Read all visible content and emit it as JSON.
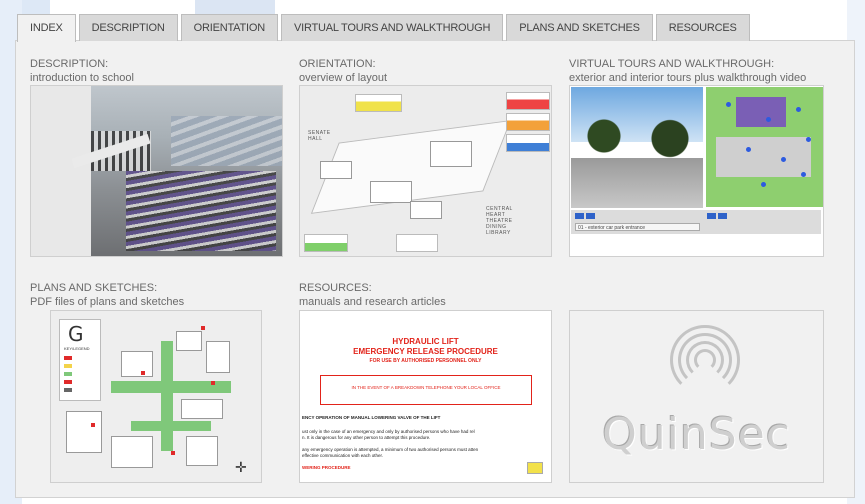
{
  "tabs": [
    {
      "label": "INDEX",
      "active": true
    },
    {
      "label": "DESCRIPTION",
      "active": false
    },
    {
      "label": "ORIENTATION",
      "active": false
    },
    {
      "label": "VIRTUAL TOURS AND WALKTHROUGH",
      "active": false
    },
    {
      "label": "PLANS AND SKETCHES",
      "active": false
    },
    {
      "label": "RESOURCES",
      "active": false
    }
  ],
  "cards": {
    "description": {
      "title": "DESCRIPTION:",
      "subtitle": "introduction to school"
    },
    "orientation": {
      "title": "ORIENTATION:",
      "subtitle": "overview of layout"
    },
    "virtual": {
      "title": "VIRTUAL TOURS AND WALKTHROUGH:",
      "subtitle": "exterior and interior tours plus walkthrough video"
    },
    "plans": {
      "title": "PLANS AND SKETCHES:",
      "subtitle": "PDF files of plans and sketches"
    },
    "resources": {
      "title": "RESOURCES:",
      "subtitle": "manuals and research articles"
    }
  },
  "orientation_thumb": {
    "label_left": "SENATE HALL",
    "label_right": "CENTRAL HEART THEATRE DINING LIBRARY"
  },
  "virtual_thumb": {
    "select_value": "01 - exterior car park entrance"
  },
  "plans_thumb": {
    "level_letter": "G",
    "key_caption": "KEY/LEGEND"
  },
  "resources_thumb": {
    "heading1": "HYDRAULIC LIFT",
    "heading2": "EMERGENCY RELEASE PROCEDURE",
    "heading3": "FOR USE BY AUTHORISED PERSONNEL ONLY",
    "box_text": "IN THE EVENT OF A BREAKDOWN TELEPHONE YOUR LOCAL OFFICE",
    "line1": "ENCY OPERATION OF MANUAL LOWERING VALVE OF THE LIFT",
    "line2": "ust only in the case of an emergency and only by authorised persons who have had rel",
    "line3": "n. It is dangerous for any other person to attempt this procedure.",
    "line4": "any emergency operation is attempted, a minimum of two authorised persons must atten",
    "line5": "effective communication with each other.",
    "line6": "WERING PROCEDURE"
  },
  "logo": {
    "word": "QuinSec"
  },
  "colors": {
    "panel_bg": "#f1f1f1",
    "tab_bg": "#d9d9d9",
    "accent_red": "#e2231a",
    "logo_grey": "#c4c4c4"
  }
}
